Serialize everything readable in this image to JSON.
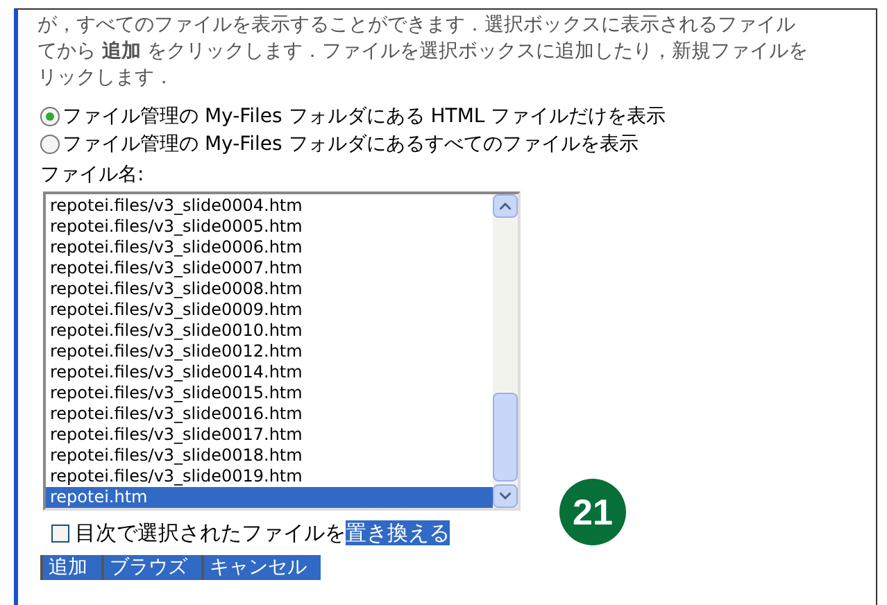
{
  "intro_lines": [
    "が，すべてのファイルを表示することができます．選択ボックスに表示されるファイル",
    "てから **追加** をクリックします．ファイルを選択ボックスに追加したり，新規ファイルを",
    "リックします．"
  ],
  "filter_options": [
    {
      "label": "ファイル管理の My-Files フォルダにある HTML ファイルだけを表示",
      "selected": true
    },
    {
      "label": "ファイル管理の My-Files フォルダにあるすべてのファイルを表示",
      "selected": false
    }
  ],
  "file_label": "ファイル名:",
  "files": [
    {
      "name": "repotei.files/v3_slide0004.htm",
      "selected": false
    },
    {
      "name": "repotei.files/v3_slide0005.htm",
      "selected": false
    },
    {
      "name": "repotei.files/v3_slide0006.htm",
      "selected": false
    },
    {
      "name": "repotei.files/v3_slide0007.htm",
      "selected": false
    },
    {
      "name": "repotei.files/v3_slide0008.htm",
      "selected": false
    },
    {
      "name": "repotei.files/v3_slide0009.htm",
      "selected": false
    },
    {
      "name": "repotei.files/v3_slide0010.htm",
      "selected": false
    },
    {
      "name": "repotei.files/v3_slide0012.htm",
      "selected": false
    },
    {
      "name": "repotei.files/v3_slide0014.htm",
      "selected": false
    },
    {
      "name": "repotei.files/v3_slide0015.htm",
      "selected": false
    },
    {
      "name": "repotei.files/v3_slide0016.htm",
      "selected": false
    },
    {
      "name": "repotei.files/v3_slide0017.htm",
      "selected": false
    },
    {
      "name": "repotei.files/v3_slide0018.htm",
      "selected": false
    },
    {
      "name": "repotei.files/v3_slide0019.htm",
      "selected": false
    },
    {
      "name": "repotei.htm",
      "selected": true
    }
  ],
  "replace_option": {
    "label": "目次で選択されたファイルを",
    "highlighted": "置き換える",
    "checked": false
  },
  "buttons": [
    "追加",
    "ブラウズ",
    "キャンセル"
  ],
  "step_badge": "21"
}
